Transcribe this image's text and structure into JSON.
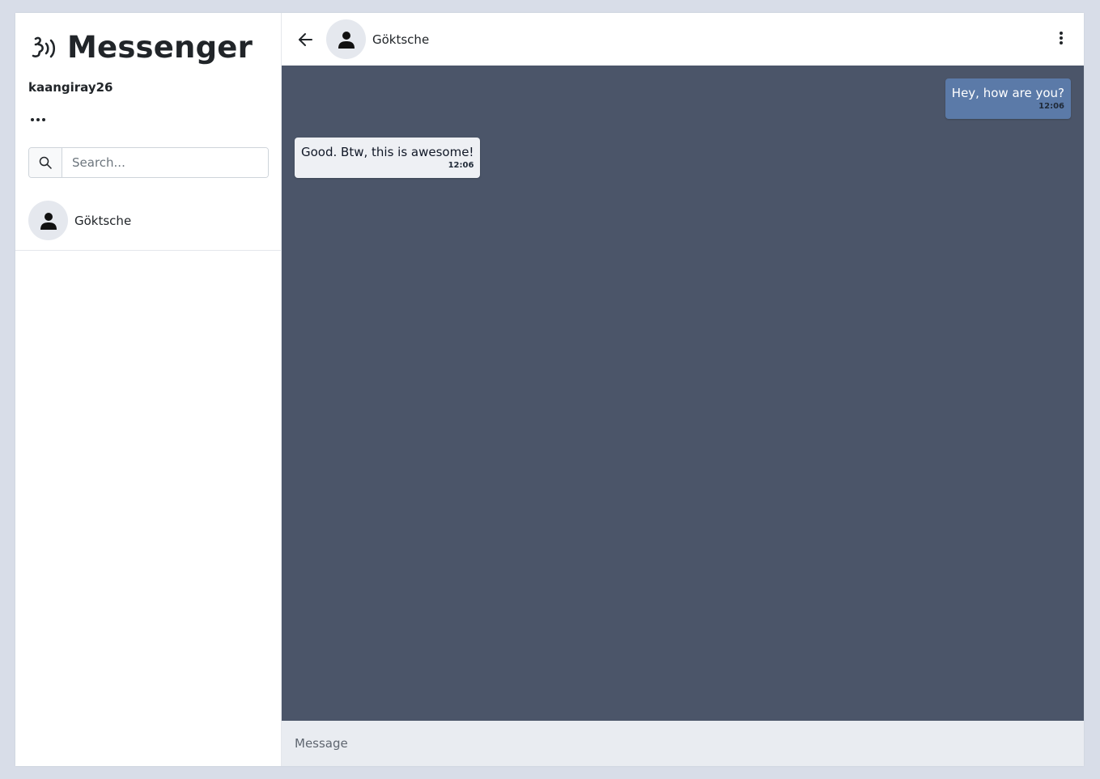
{
  "app": {
    "title": "Messenger",
    "username": "kaangiray26"
  },
  "sidebar": {
    "more_icon": "ellipsis-icon",
    "search": {
      "placeholder": "Search...",
      "value": "",
      "icon": "search-icon"
    },
    "contacts": [
      {
        "name": "Göktsche",
        "avatar_icon": "person-icon"
      }
    ]
  },
  "chat": {
    "header": {
      "back_icon": "arrow-left-icon",
      "contact_name": "Göktsche",
      "menu_icon": "kebab-menu-icon"
    },
    "messages": [
      {
        "direction": "outgoing",
        "text": "Hey, how are you?",
        "time": "12:06"
      },
      {
        "direction": "incoming",
        "text": "Good. Btw, this is awesome!",
        "time": "12:06"
      }
    ],
    "composer": {
      "placeholder": "Message",
      "value": ""
    }
  },
  "colors": {
    "chat_background": "#4b5569",
    "outgoing_bubble": "#5b7aa8",
    "incoming_bubble": "#eef0f4",
    "composer_background": "#e9ecf1",
    "page_background": "#d8dde8"
  }
}
